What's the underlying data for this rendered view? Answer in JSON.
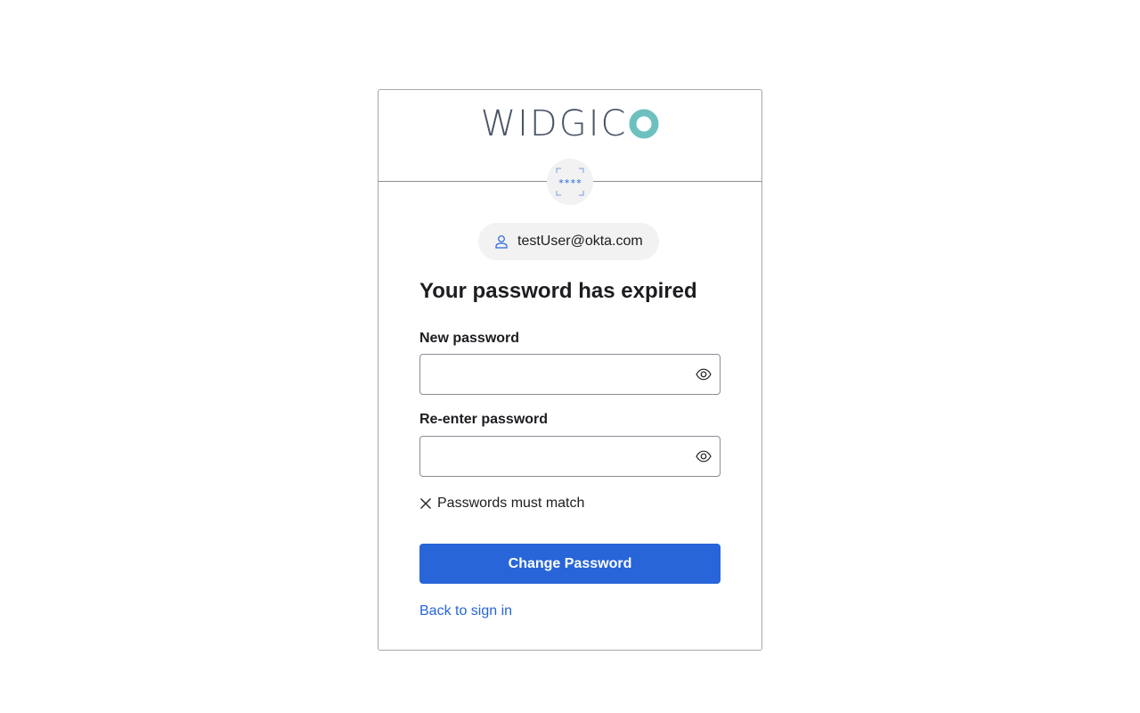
{
  "brand": {
    "logo_text": "WIDGIC",
    "logo_accent_color": "#6cc0c0",
    "logo_text_color": "#4a5566"
  },
  "factor": {
    "icon": "password-icon",
    "glyph": "****"
  },
  "user": {
    "icon": "user-icon",
    "identifier": "testUser@okta.com"
  },
  "page": {
    "title": "Your password has expired"
  },
  "form": {
    "new_password": {
      "label": "New password",
      "value": "",
      "placeholder": "",
      "toggle_icon": "eye-icon"
    },
    "confirm_password": {
      "label": "Re-enter password",
      "value": "",
      "placeholder": "",
      "toggle_icon": "eye-icon"
    },
    "requirements": [
      {
        "icon": "close-icon",
        "text": "Passwords must match",
        "met": false
      }
    ],
    "submit_label": "Change Password"
  },
  "links": {
    "back_to_sign_in": "Back to sign in"
  },
  "colors": {
    "primary": "#2765d8",
    "border": "#8c8c96",
    "text": "#1d1d21",
    "pill_bg": "#f2f2f3"
  }
}
